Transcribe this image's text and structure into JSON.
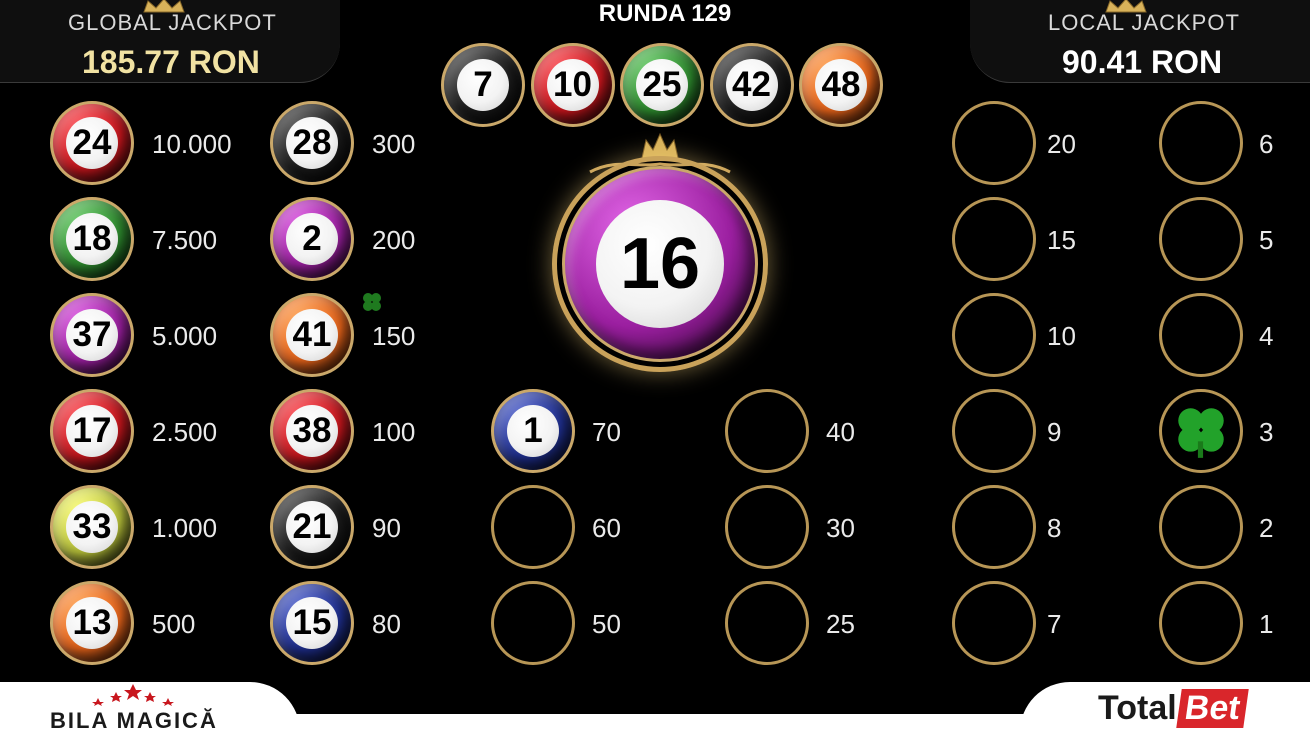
{
  "header": {
    "global_title": "GLOBAL  JACKPOT",
    "global_value": "185.77 RON",
    "round_title": "RUNDA 129",
    "local_title": "LOCAL  JACKPOT",
    "local_value": "90.41 RON"
  },
  "colors": {
    "red": "#c8161d",
    "black": "#1a1a1a",
    "green": "#2e8b2e",
    "purple": "#9b1fa0",
    "orange": "#e8641a",
    "yellow": "#b8c23a",
    "blue": "#1f2f8f",
    "gold": "#c9a25a",
    "global_value": "#f1e2a3"
  },
  "drawn_balls": [
    {
      "number": "7",
      "color": "black"
    },
    {
      "number": "10",
      "color": "red"
    },
    {
      "number": "25",
      "color": "green"
    },
    {
      "number": "42",
      "color": "black"
    },
    {
      "number": "48",
      "color": "orange"
    }
  ],
  "current_ball": {
    "number": "16",
    "color": "purple"
  },
  "left_col1": [
    {
      "number": "24",
      "color": "red",
      "prize": "10.000"
    },
    {
      "number": "18",
      "color": "green",
      "prize": "7.500"
    },
    {
      "number": "37",
      "color": "purple",
      "prize": "5.000"
    },
    {
      "number": "17",
      "color": "red",
      "prize": "2.500"
    },
    {
      "number": "33",
      "color": "yellow",
      "prize": "1.000"
    },
    {
      "number": "13",
      "color": "orange",
      "prize": "500"
    }
  ],
  "left_col2": [
    {
      "number": "28",
      "color": "black",
      "prize": "300"
    },
    {
      "number": "2",
      "color": "purple",
      "prize": "200"
    },
    {
      "number": "41",
      "color": "orange",
      "prize": "150"
    },
    {
      "number": "38",
      "color": "red",
      "prize": "100"
    },
    {
      "number": "21",
      "color": "black",
      "prize": "90"
    },
    {
      "number": "15",
      "color": "blue",
      "prize": "80"
    }
  ],
  "mid_col1": [
    {
      "number": "1",
      "color": "blue",
      "prize": "70"
    },
    {
      "number": "",
      "color": "",
      "prize": "60"
    },
    {
      "number": "",
      "color": "",
      "prize": "50"
    }
  ],
  "mid_col2": [
    {
      "prize": "40"
    },
    {
      "prize": "30"
    },
    {
      "prize": "25"
    }
  ],
  "right_col1": [
    {
      "prize": "20"
    },
    {
      "prize": "15"
    },
    {
      "prize": "10"
    },
    {
      "prize": "9"
    },
    {
      "prize": "8"
    },
    {
      "prize": "7"
    }
  ],
  "right_col2": [
    {
      "prize": "6"
    },
    {
      "prize": "5"
    },
    {
      "prize": "4"
    },
    {
      "prize": "3",
      "clover": true
    },
    {
      "prize": "2"
    },
    {
      "prize": "1"
    }
  ],
  "footer": {
    "brand_left": "BILA MAGICĂ",
    "brand_right_a": "Total",
    "brand_right_b": "Bet"
  },
  "icons": {
    "crown": "crown-icon",
    "clover": "clover-icon",
    "stars": "stars-icon"
  }
}
